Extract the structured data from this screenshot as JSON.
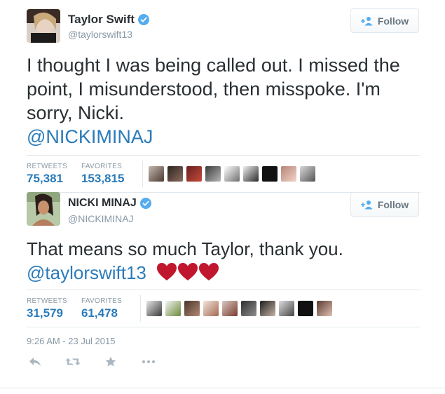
{
  "tweet1": {
    "user": {
      "name": "Taylor Swift",
      "handle": "@taylorswift13"
    },
    "follow_label": "Follow",
    "text": "I thought I was being called out. I missed the point, I misunderstood, then misspoke. I'm sorry, Nicki.",
    "mention": "@NICKIMINAJ",
    "stats": {
      "retweets_label": "RETWEETS",
      "retweets": "75,381",
      "favorites_label": "FAVORITES",
      "favorites": "153,815"
    }
  },
  "tweet2": {
    "user": {
      "name": "NICKI MINAJ",
      "handle": "@NICKIMINAJ"
    },
    "follow_label": "Follow",
    "text": "That means so much Taylor, thank you.",
    "mention": "@taylorswift13",
    "stats": {
      "retweets_label": "RETWEETS",
      "retweets": "31,579",
      "favorites_label": "FAVORITES",
      "favorites": "61,478"
    },
    "timestamp": "9:26 AM - 23 Jul 2015"
  },
  "colors": {
    "link": "#2b7bb9",
    "verified": "#55acee",
    "heart": "#c0172e"
  },
  "icons": [
    "verified-icon",
    "follow-person-icon",
    "reply-icon",
    "retweet-icon",
    "favorite-icon",
    "more-icon",
    "heart-icon"
  ]
}
